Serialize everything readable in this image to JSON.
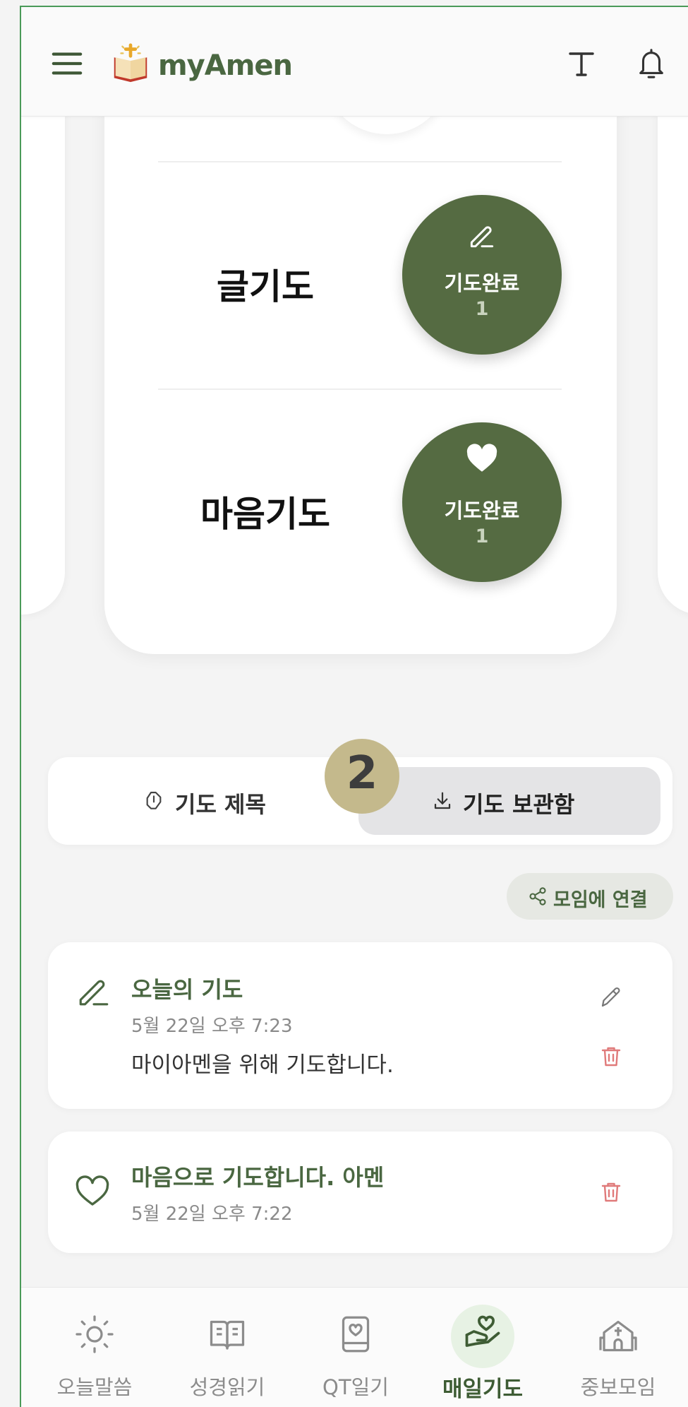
{
  "app": {
    "name": "myAmen"
  },
  "prayers": [
    {
      "label": "글기도",
      "status": "기도완료",
      "count": "1",
      "icon": "pencil-icon"
    },
    {
      "label": "마음기도",
      "status": "기도완료",
      "count": "1",
      "icon": "heart-icon"
    }
  ],
  "step_badge": "2",
  "tabs": [
    {
      "label": "기도 제목",
      "icon": "prayer-hands-icon",
      "active": false
    },
    {
      "label": "기도 보관함",
      "icon": "download-icon",
      "active": true
    }
  ],
  "connect_button": {
    "label": "모임에 연결",
    "icon": "share-icon"
  },
  "entries": [
    {
      "icon": "pencil-icon",
      "title": "오늘의 기도",
      "date": "5월 22일 오후 7:23",
      "body": "마이아멘을 위해 기도합니다."
    },
    {
      "icon": "heart-outline-icon",
      "title": "마음으로 기도합니다. 아멘",
      "date": "5월 22일 오후 7:22"
    }
  ],
  "nav": [
    {
      "label": "오늘말씀",
      "icon": "sun-icon",
      "active": false
    },
    {
      "label": "성경읽기",
      "icon": "open-book-icon",
      "active": false
    },
    {
      "label": "QT일기",
      "icon": "diary-icon",
      "active": false
    },
    {
      "label": "매일기도",
      "icon": "prayer-hand-heart-icon",
      "active": true
    },
    {
      "label": "중보모임",
      "icon": "church-icon",
      "active": false
    }
  ],
  "colors": {
    "accent": "#556b42",
    "brand_text": "#4a6741",
    "delete": "#e07a7a",
    "badge": "#c4b98c"
  }
}
